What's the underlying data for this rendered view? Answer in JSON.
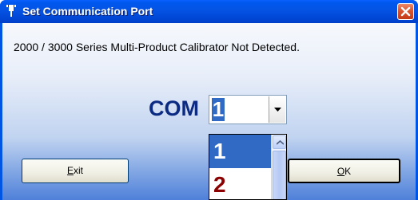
{
  "window": {
    "title": "Set Communication Port"
  },
  "message": "2000 / 3000 Series Multi-Product Calibrator Not Detected.",
  "port": {
    "label": "COM",
    "selected": "1",
    "options": [
      "1",
      "2"
    ]
  },
  "buttons": {
    "exit_mnemonic": "E",
    "exit_rest": "xit",
    "ok_mnemonic": "O",
    "ok_rest": "K"
  },
  "colors": {
    "titlebar": "#0058ee",
    "selection": "#316ac5",
    "com_label": "#0b2a82",
    "option_text": "#8b0000"
  },
  "icons": {
    "title": "port-plug-icon",
    "close": "close-icon",
    "dropdown": "chevron-down-icon",
    "scroll_up": "scroll-up-arrow-icon"
  }
}
